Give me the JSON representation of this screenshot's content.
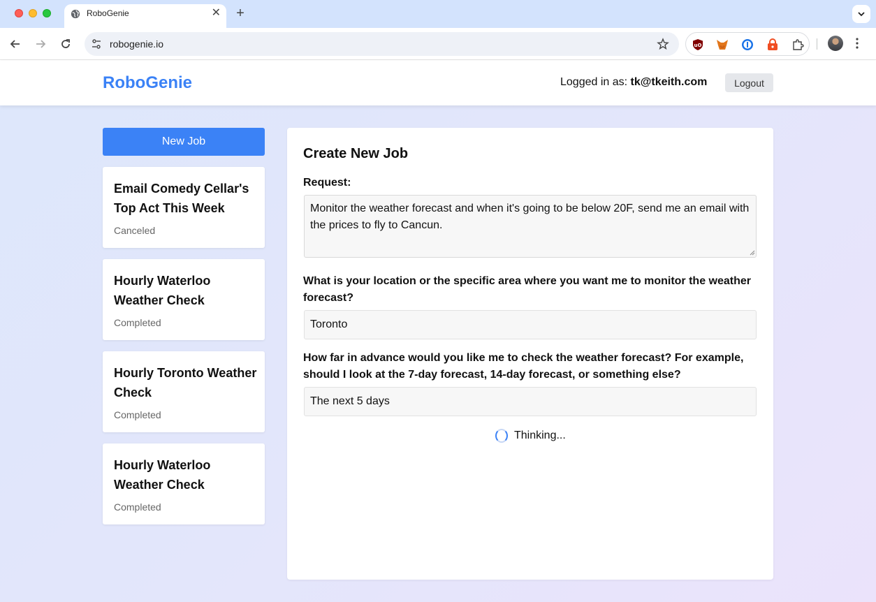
{
  "browser": {
    "tab_title": "RoboGenie",
    "url": "robogenie.io"
  },
  "header": {
    "brand": "RoboGenie",
    "logged_in_label": "Logged in as:",
    "user_email": "tk@tkeith.com",
    "logout_label": "Logout"
  },
  "sidebar": {
    "new_job_label": "New Job",
    "jobs": [
      {
        "title": "Email Comedy Cellar's Top Act This Week",
        "status": "Canceled"
      },
      {
        "title": "Hourly Waterloo Weather Check",
        "status": "Completed"
      },
      {
        "title": "Hourly Toronto Weather Check",
        "status": "Completed"
      },
      {
        "title": "Hourly Waterloo Weather Check",
        "status": "Completed"
      }
    ]
  },
  "form": {
    "title": "Create New Job",
    "request_label": "Request:",
    "request_value": "Monitor the weather forecast and when it's going to be below 20F, send me an email with the prices to fly to Cancun.",
    "questions": [
      {
        "label": "What is your location or the specific area where you want me to monitor the weather forecast?",
        "answer": "Toronto"
      },
      {
        "label": "How far in advance would you like me to check the weather forecast? For example, should I look at the 7-day forecast, 14-day forecast, or something else?",
        "answer": "The next 5 days"
      }
    ],
    "status_text": "Thinking..."
  },
  "colors": {
    "accent": "#3b82f6",
    "tabstrip": "#d3e3fd"
  }
}
